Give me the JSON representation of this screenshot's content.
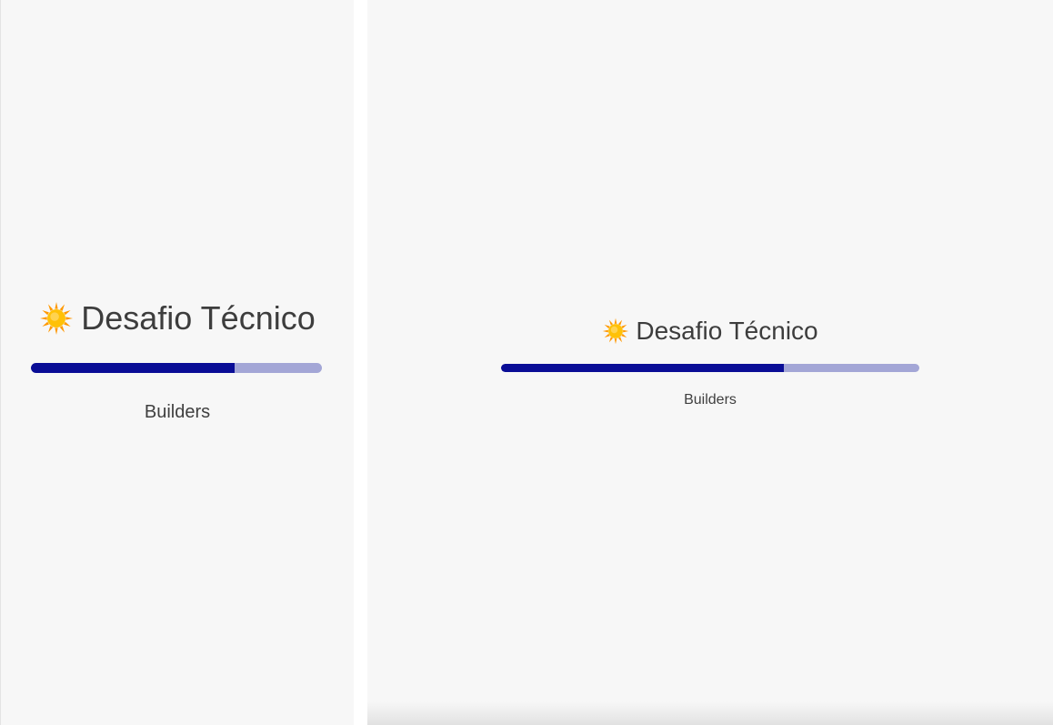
{
  "app": {
    "title": "Desafio Técnico",
    "subtitle": "Builders",
    "title_icon": "sun-icon"
  },
  "loading": {
    "progress_fraction_left": 0.7,
    "progress_fraction_right": 0.675
  },
  "colors": {
    "background": "#f7f7f7",
    "progress_fill": "#0a0d96",
    "progress_track": "#a3a6d6",
    "text": "#3d3d3d",
    "sun_core": "#ffc107",
    "sun_rays": "#ff9800"
  }
}
